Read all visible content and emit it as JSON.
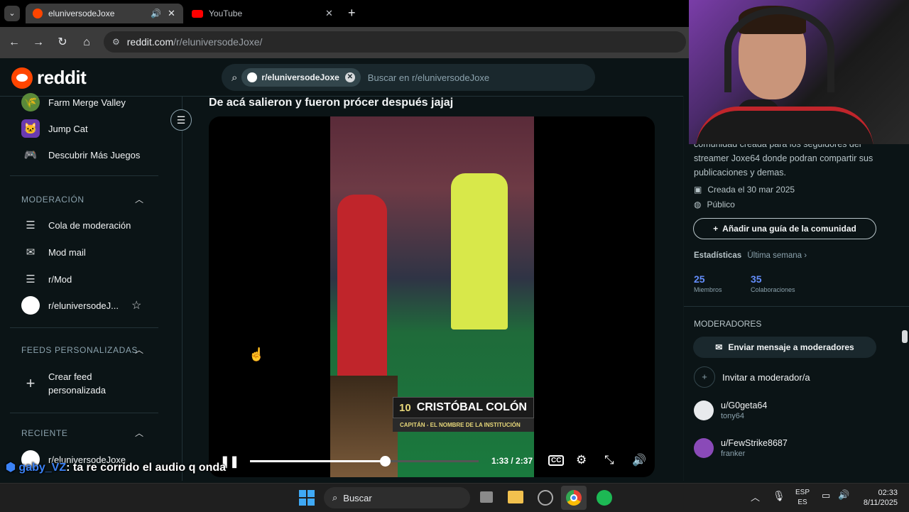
{
  "browser": {
    "tabs": [
      {
        "label": "eluniversodeJoxe",
        "active": true
      },
      {
        "label": "YouTube",
        "active": false
      }
    ],
    "url_host": "reddit.com",
    "url_path": "/r/eluniversodeJoxe/"
  },
  "reddit": {
    "logo_text": "reddit",
    "search_chip": "r/eluniversodeJoxe",
    "search_placeholder": "Buscar en r/eluniversodeJoxe"
  },
  "sidebar": {
    "games": [
      "Farm Merge Valley",
      "Jump Cat",
      "Descubrir Más Juegos"
    ],
    "moderation_header": "MODERACIÓN",
    "moderation_items": [
      "Cola de moderación",
      "Mod mail",
      "r/Mod",
      "r/eluniversodeJ..."
    ],
    "feeds_header": "FEEDS PERSONALIZADAS",
    "create_feed": "Crear feed personalizada",
    "recent_header": "RECIENTE",
    "recent_items": [
      "r/eluniversodeJoxe"
    ]
  },
  "post": {
    "title": "De acá salieron y fueron prócer después jajaj",
    "overlay_number": "10",
    "overlay_name": "CRISTÓBAL COLÓN",
    "overlay_sub": "CAPITÁN - EL NOMBRE DE LA INSTITUCIÓN",
    "time": "1:33 / 2:37",
    "progress": 0.59
  },
  "right_panel": {
    "description": "comunidad creada para los seguidores del streamer Joxe64 donde podran compartir sus publicaciones y demas.",
    "created": "Creada el 30 mar 2025",
    "visibility": "Público",
    "add_guide": "Añadir una guía de la comunidad",
    "stats_label": "Estadísticas",
    "stats_period": "Última semana",
    "members_value": "25",
    "members_label": "Miembros",
    "contrib_value": "35",
    "contrib_label": "Colaboraciones",
    "moderators_header": "MODERADORES",
    "message_mods": "Enviar mensaje a moderadores",
    "invite_mod": "Invitar a moderador/a",
    "mods": [
      {
        "user": "u/G0geta64",
        "flair": "tony64"
      },
      {
        "user": "u/FewStrike8687",
        "flair": "franker"
      }
    ]
  },
  "chat": {
    "user": "gaby_VZ",
    "message": ": ta re corrido el audio q onda"
  },
  "taskbar": {
    "search": "Buscar",
    "lang_top": "ESP",
    "lang_bottom": "ES",
    "time": "02:33",
    "date": "8/11/2025"
  },
  "colors": {
    "reddit_orange": "#ff4500",
    "accent_blue": "#648efc"
  }
}
